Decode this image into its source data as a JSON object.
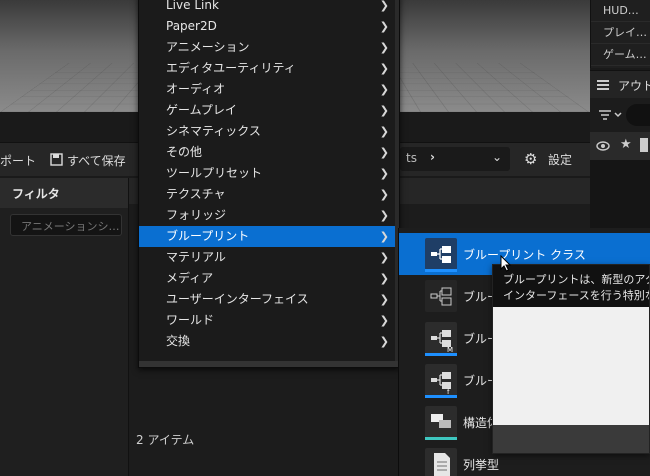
{
  "right_panel": {
    "rows": [
      "HUD…",
      "プレイ…",
      "ゲーム…"
    ],
    "outliner_title": "アウト…"
  },
  "toolbar": {
    "import_label": "ポート",
    "save_all_label": "すべて保存",
    "path_text": "ts",
    "settings_label": "設定"
  },
  "filter_panel": {
    "title": "フィルタ",
    "search_placeholder": "アニメーションシ…"
  },
  "content": {
    "item_count": "2 アイテム"
  },
  "menu": {
    "items": [
      {
        "label": "Live Link"
      },
      {
        "label": "Paper2D"
      },
      {
        "label": "アニメーション"
      },
      {
        "label": "エディタユーティリティ"
      },
      {
        "label": "オーディオ"
      },
      {
        "label": "ゲームプレイ"
      },
      {
        "label": "シネマティックス"
      },
      {
        "label": "その他"
      },
      {
        "label": "ツールプリセット"
      },
      {
        "label": "テクスチャ"
      },
      {
        "label": "フォリッジ"
      },
      {
        "label": "ブループリント",
        "highlighted": true
      },
      {
        "label": "マテリアル"
      },
      {
        "label": "メディア"
      },
      {
        "label": "ユーザーインターフェイス"
      },
      {
        "label": "ワールド"
      },
      {
        "label": "交換"
      }
    ]
  },
  "submenu": {
    "items": [
      {
        "label": "ブループリント クラス",
        "icon": "blueprint-class-icon",
        "bar": "blue",
        "highlighted": true
      },
      {
        "label": "ブルー",
        "icon": "blueprint-interface-icon",
        "bar": "blue"
      },
      {
        "label": "ブルー",
        "icon": "blueprint-macro-icon",
        "bar": "blue"
      },
      {
        "label": "ブルー",
        "icon": "blueprint-function-library-icon",
        "bar": "blue"
      },
      {
        "label": "構造体",
        "icon": "structure-icon",
        "bar": "teal"
      },
      {
        "label": "列挙型",
        "icon": "enumeration-icon",
        "bar": "red"
      }
    ]
  },
  "tooltip": {
    "line1": "ブループリントは、新型のアクタ",
    "line2": "インターフェースを行う特別な"
  },
  "colors": {
    "highlight": "#0a6fd1",
    "blueprint_bar": "#1e90ff",
    "struct_bar": "#3ec7c0",
    "enum_bar": "#d24d4d"
  }
}
